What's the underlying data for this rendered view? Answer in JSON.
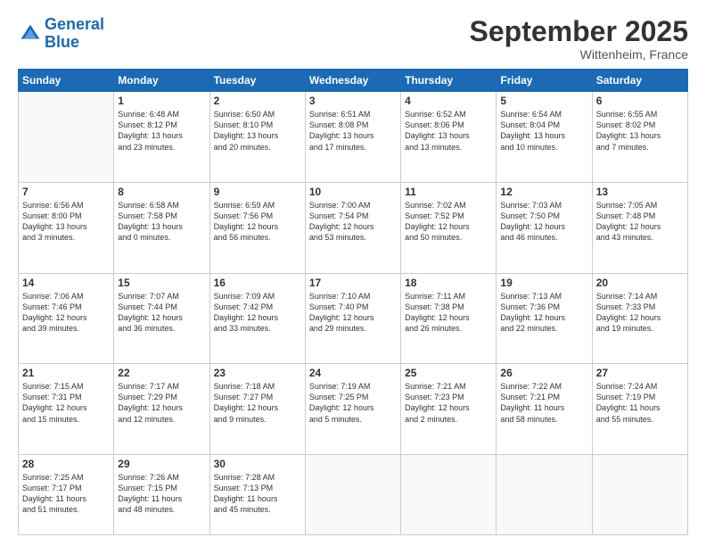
{
  "header": {
    "logo_line1": "General",
    "logo_line2": "Blue",
    "month": "September 2025",
    "location": "Wittenheim, France"
  },
  "days_of_week": [
    "Sunday",
    "Monday",
    "Tuesday",
    "Wednesday",
    "Thursday",
    "Friday",
    "Saturday"
  ],
  "weeks": [
    [
      {
        "day": "",
        "info": ""
      },
      {
        "day": "1",
        "info": "Sunrise: 6:48 AM\nSunset: 8:12 PM\nDaylight: 13 hours\nand 23 minutes."
      },
      {
        "day": "2",
        "info": "Sunrise: 6:50 AM\nSunset: 8:10 PM\nDaylight: 13 hours\nand 20 minutes."
      },
      {
        "day": "3",
        "info": "Sunrise: 6:51 AM\nSunset: 8:08 PM\nDaylight: 13 hours\nand 17 minutes."
      },
      {
        "day": "4",
        "info": "Sunrise: 6:52 AM\nSunset: 8:06 PM\nDaylight: 13 hours\nand 13 minutes."
      },
      {
        "day": "5",
        "info": "Sunrise: 6:54 AM\nSunset: 8:04 PM\nDaylight: 13 hours\nand 10 minutes."
      },
      {
        "day": "6",
        "info": "Sunrise: 6:55 AM\nSunset: 8:02 PM\nDaylight: 13 hours\nand 7 minutes."
      }
    ],
    [
      {
        "day": "7",
        "info": "Sunrise: 6:56 AM\nSunset: 8:00 PM\nDaylight: 13 hours\nand 3 minutes."
      },
      {
        "day": "8",
        "info": "Sunrise: 6:58 AM\nSunset: 7:58 PM\nDaylight: 13 hours\nand 0 minutes."
      },
      {
        "day": "9",
        "info": "Sunrise: 6:59 AM\nSunset: 7:56 PM\nDaylight: 12 hours\nand 56 minutes."
      },
      {
        "day": "10",
        "info": "Sunrise: 7:00 AM\nSunset: 7:54 PM\nDaylight: 12 hours\nand 53 minutes."
      },
      {
        "day": "11",
        "info": "Sunrise: 7:02 AM\nSunset: 7:52 PM\nDaylight: 12 hours\nand 50 minutes."
      },
      {
        "day": "12",
        "info": "Sunrise: 7:03 AM\nSunset: 7:50 PM\nDaylight: 12 hours\nand 46 minutes."
      },
      {
        "day": "13",
        "info": "Sunrise: 7:05 AM\nSunset: 7:48 PM\nDaylight: 12 hours\nand 43 minutes."
      }
    ],
    [
      {
        "day": "14",
        "info": "Sunrise: 7:06 AM\nSunset: 7:46 PM\nDaylight: 12 hours\nand 39 minutes."
      },
      {
        "day": "15",
        "info": "Sunrise: 7:07 AM\nSunset: 7:44 PM\nDaylight: 12 hours\nand 36 minutes."
      },
      {
        "day": "16",
        "info": "Sunrise: 7:09 AM\nSunset: 7:42 PM\nDaylight: 12 hours\nand 33 minutes."
      },
      {
        "day": "17",
        "info": "Sunrise: 7:10 AM\nSunset: 7:40 PM\nDaylight: 12 hours\nand 29 minutes."
      },
      {
        "day": "18",
        "info": "Sunrise: 7:11 AM\nSunset: 7:38 PM\nDaylight: 12 hours\nand 26 minutes."
      },
      {
        "day": "19",
        "info": "Sunrise: 7:13 AM\nSunset: 7:36 PM\nDaylight: 12 hours\nand 22 minutes."
      },
      {
        "day": "20",
        "info": "Sunrise: 7:14 AM\nSunset: 7:33 PM\nDaylight: 12 hours\nand 19 minutes."
      }
    ],
    [
      {
        "day": "21",
        "info": "Sunrise: 7:15 AM\nSunset: 7:31 PM\nDaylight: 12 hours\nand 15 minutes."
      },
      {
        "day": "22",
        "info": "Sunrise: 7:17 AM\nSunset: 7:29 PM\nDaylight: 12 hours\nand 12 minutes."
      },
      {
        "day": "23",
        "info": "Sunrise: 7:18 AM\nSunset: 7:27 PM\nDaylight: 12 hours\nand 9 minutes."
      },
      {
        "day": "24",
        "info": "Sunrise: 7:19 AM\nSunset: 7:25 PM\nDaylight: 12 hours\nand 5 minutes."
      },
      {
        "day": "25",
        "info": "Sunrise: 7:21 AM\nSunset: 7:23 PM\nDaylight: 12 hours\nand 2 minutes."
      },
      {
        "day": "26",
        "info": "Sunrise: 7:22 AM\nSunset: 7:21 PM\nDaylight: 11 hours\nand 58 minutes."
      },
      {
        "day": "27",
        "info": "Sunrise: 7:24 AM\nSunset: 7:19 PM\nDaylight: 11 hours\nand 55 minutes."
      }
    ],
    [
      {
        "day": "28",
        "info": "Sunrise: 7:25 AM\nSunset: 7:17 PM\nDaylight: 11 hours\nand 51 minutes."
      },
      {
        "day": "29",
        "info": "Sunrise: 7:26 AM\nSunset: 7:15 PM\nDaylight: 11 hours\nand 48 minutes."
      },
      {
        "day": "30",
        "info": "Sunrise: 7:28 AM\nSunset: 7:13 PM\nDaylight: 11 hours\nand 45 minutes."
      },
      {
        "day": "",
        "info": ""
      },
      {
        "day": "",
        "info": ""
      },
      {
        "day": "",
        "info": ""
      },
      {
        "day": "",
        "info": ""
      }
    ]
  ]
}
